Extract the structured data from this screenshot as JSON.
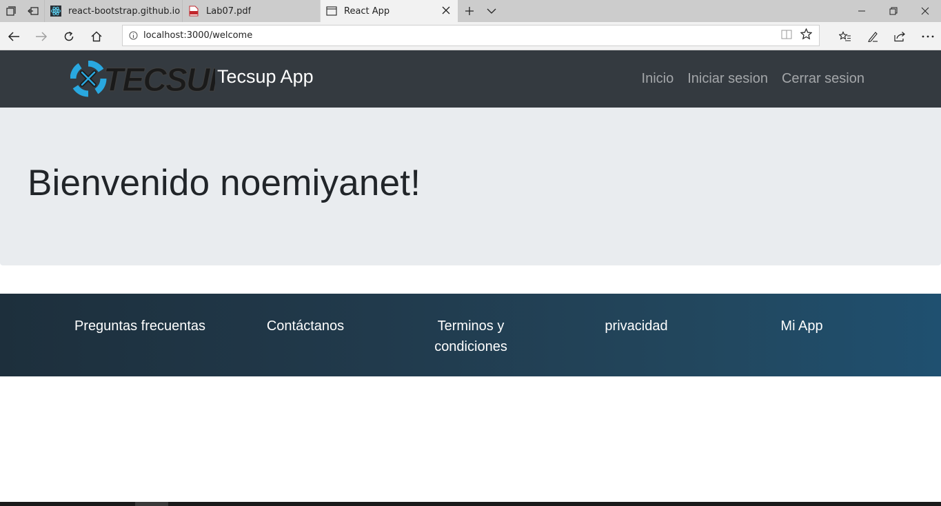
{
  "browser": {
    "tabs": [
      {
        "label": "react-bootstrap.github.io",
        "icon": "react-logo-icon",
        "active": false
      },
      {
        "label": "Lab07.pdf",
        "icon": "pdf-icon",
        "active": false
      },
      {
        "label": "React App",
        "icon": "page-icon",
        "active": true
      }
    ],
    "url": "localhost:3000/welcome"
  },
  "navbar": {
    "brand": "Tecsup App",
    "logo_text": "TECSUP",
    "links": [
      "Inicio",
      "Iniciar sesion",
      "Cerrar sesion"
    ]
  },
  "jumbotron": {
    "title": "Bienvenido noemiyanet!"
  },
  "footer": {
    "links": [
      "Preguntas frecuentas",
      "Contáctanos",
      "Terminos y condiciones",
      "privacidad",
      "Mi App"
    ]
  },
  "colors": {
    "navbar_bg": "#343a40",
    "jumbotron_bg": "#e9ecef",
    "footer_start": "#1d2f3c",
    "footer_end": "#1f5070",
    "logo_blue": "#29a8e0"
  }
}
